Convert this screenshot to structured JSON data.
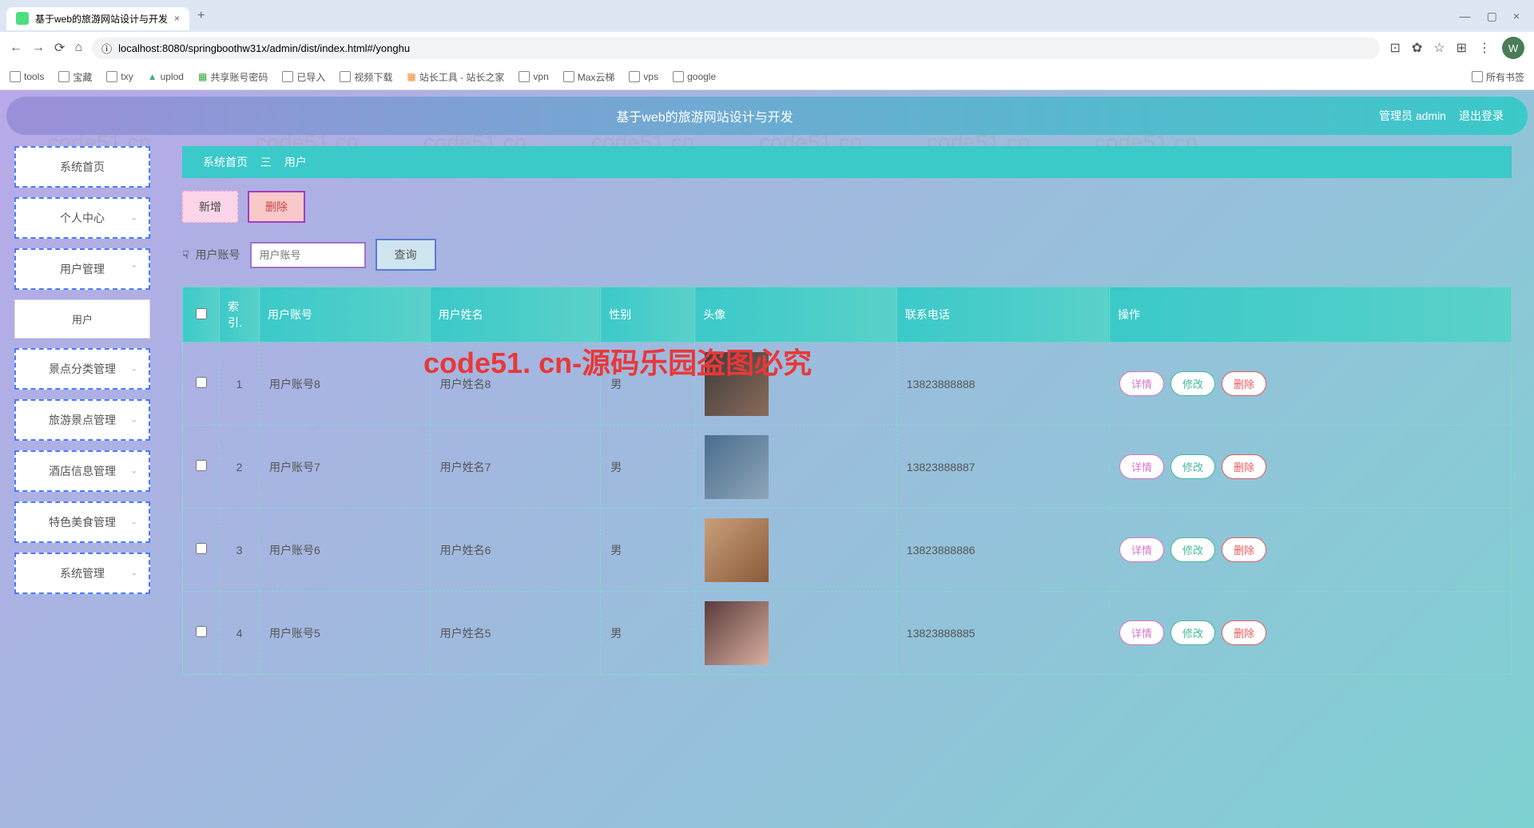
{
  "browser": {
    "tab_title": "基于web的旅游网站设计与开发",
    "url": "localhost:8080/springboothw31x/admin/dist/index.html#/yonghu",
    "avatar_letter": "W",
    "bookmarks": [
      "tools",
      "宝藏",
      "txy",
      "uplod",
      "共享账号密码",
      "已导入",
      "视频下载",
      "站长工具 - 站长之家",
      "vpn",
      "Max云梯",
      "vps",
      "google"
    ],
    "all_bookmarks": "所有书签"
  },
  "header": {
    "title": "基于web的旅游网站设计与开发",
    "role": "管理员 admin",
    "logout": "退出登录"
  },
  "sidebar": {
    "items": [
      {
        "label": "系统首页",
        "expand": false
      },
      {
        "label": "个人中心",
        "expand": true
      },
      {
        "label": "用户管理",
        "expand": true
      },
      {
        "label": "用户",
        "sub": true
      },
      {
        "label": "景点分类管理",
        "expand": true
      },
      {
        "label": "旅游景点管理",
        "expand": true
      },
      {
        "label": "酒店信息管理",
        "expand": true
      },
      {
        "label": "特色美食管理",
        "expand": true
      },
      {
        "label": "系统管理",
        "expand": true
      }
    ]
  },
  "breadcrumb": {
    "home": "系统首页",
    "sep": "三",
    "current": "用户"
  },
  "buttons": {
    "add": "新增",
    "del": "删除",
    "search": "查询"
  },
  "search": {
    "label": "用户账号",
    "placeholder": "用户账号"
  },
  "table": {
    "headers": [
      "",
      "索引.",
      "用户账号",
      "用户姓名",
      "性别",
      "头像",
      "联系电话",
      "操作"
    ],
    "rows": [
      {
        "idx": "1",
        "account": "用户账号8",
        "name": "用户姓名8",
        "gender": "男",
        "phone": "13823888888"
      },
      {
        "idx": "2",
        "account": "用户账号7",
        "name": "用户姓名7",
        "gender": "男",
        "phone": "13823888887"
      },
      {
        "idx": "3",
        "account": "用户账号6",
        "name": "用户姓名6",
        "gender": "男",
        "phone": "13823888886"
      },
      {
        "idx": "4",
        "account": "用户账号5",
        "name": "用户姓名5",
        "gender": "男",
        "phone": "13823888885"
      }
    ],
    "row_btns": {
      "detail": "详情",
      "edit": "修改",
      "delete": "删除"
    }
  },
  "watermark": {
    "text": "code51.cn",
    "red": "code51. cn-源码乐园盗图必究"
  }
}
